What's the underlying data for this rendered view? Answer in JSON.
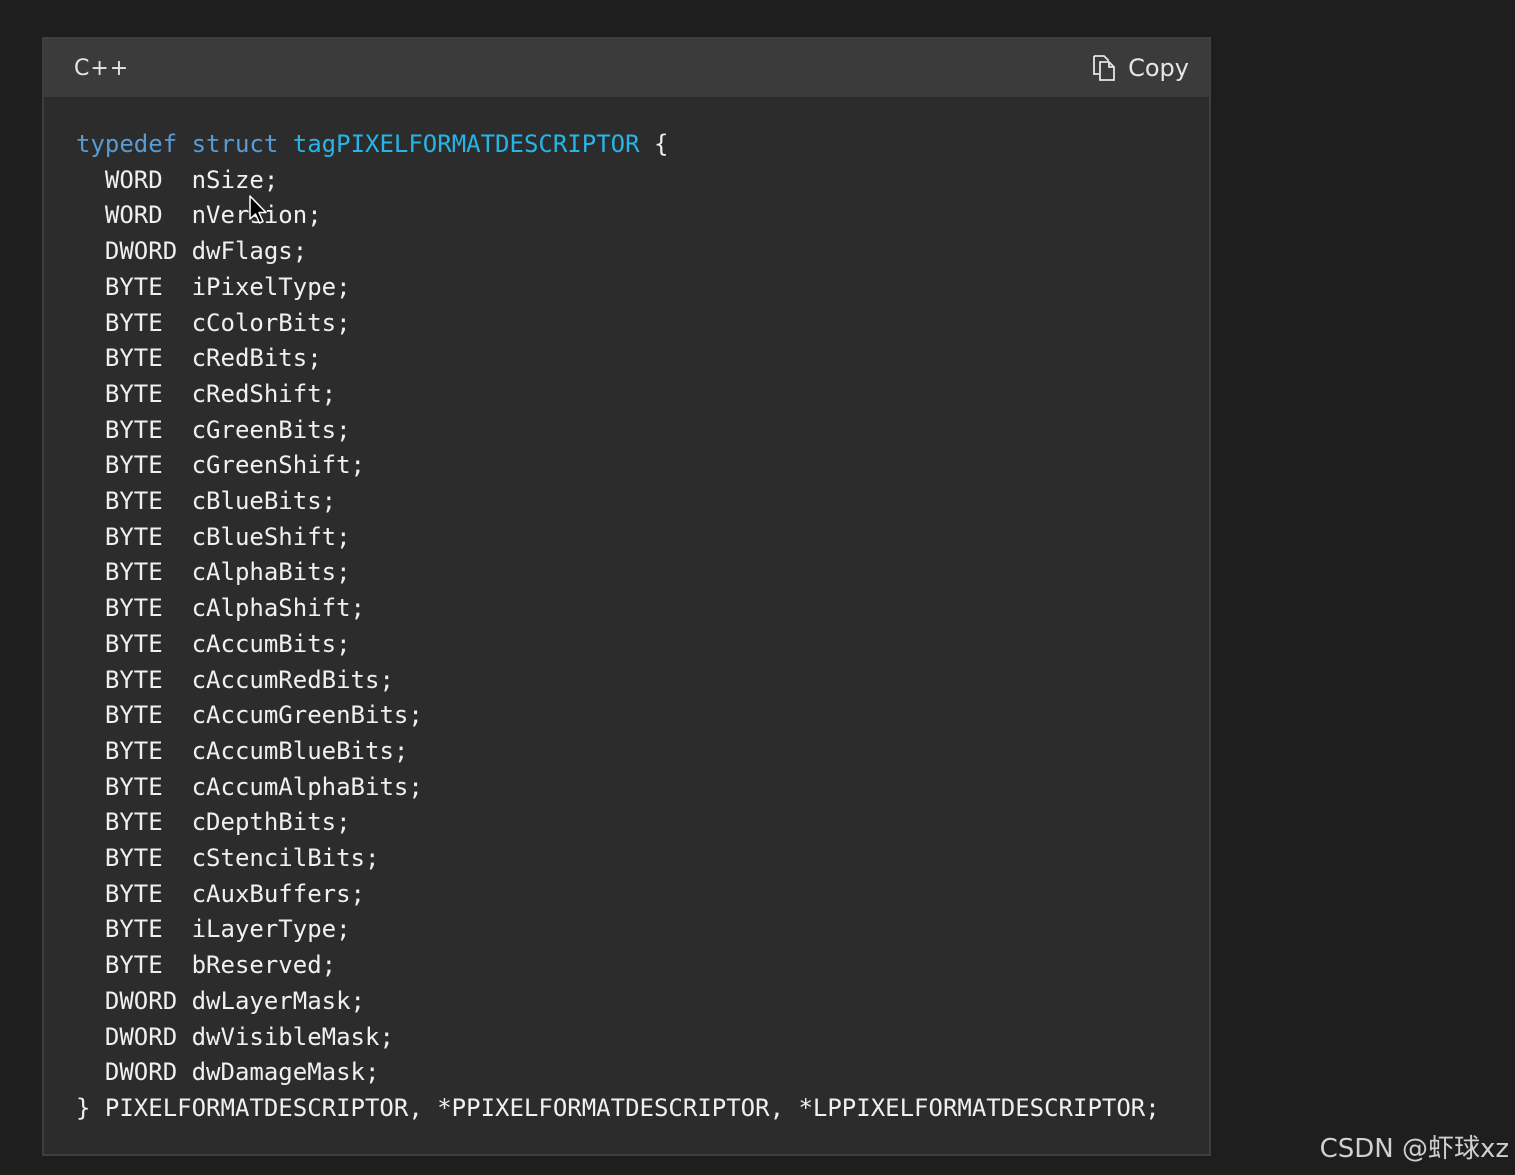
{
  "code_block": {
    "language": "C++",
    "copy_label": "Copy",
    "lines": [
      {
        "indent": "",
        "tokens": [
          {
            "t": "typedef",
            "c": "kw"
          },
          {
            "t": " ",
            "c": ""
          },
          {
            "t": "struct",
            "c": "kw"
          },
          {
            "t": " ",
            "c": ""
          },
          {
            "t": "tagPIXELFORMATDESCRIPTOR",
            "c": "tn"
          },
          {
            "t": " {",
            "c": ""
          }
        ]
      },
      {
        "indent": "  ",
        "tokens": [
          {
            "t": "WORD  nSize;",
            "c": ""
          }
        ]
      },
      {
        "indent": "  ",
        "tokens": [
          {
            "t": "WORD  nVersion;",
            "c": ""
          }
        ]
      },
      {
        "indent": "  ",
        "tokens": [
          {
            "t": "DWORD dwFlags;",
            "c": ""
          }
        ]
      },
      {
        "indent": "  ",
        "tokens": [
          {
            "t": "BYTE  iPixelType;",
            "c": ""
          }
        ]
      },
      {
        "indent": "  ",
        "tokens": [
          {
            "t": "BYTE  cColorBits;",
            "c": ""
          }
        ]
      },
      {
        "indent": "  ",
        "tokens": [
          {
            "t": "BYTE  cRedBits;",
            "c": ""
          }
        ]
      },
      {
        "indent": "  ",
        "tokens": [
          {
            "t": "BYTE  cRedShift;",
            "c": ""
          }
        ]
      },
      {
        "indent": "  ",
        "tokens": [
          {
            "t": "BYTE  cGreenBits;",
            "c": ""
          }
        ]
      },
      {
        "indent": "  ",
        "tokens": [
          {
            "t": "BYTE  cGreenShift;",
            "c": ""
          }
        ]
      },
      {
        "indent": "  ",
        "tokens": [
          {
            "t": "BYTE  cBlueBits;",
            "c": ""
          }
        ]
      },
      {
        "indent": "  ",
        "tokens": [
          {
            "t": "BYTE  cBlueShift;",
            "c": ""
          }
        ]
      },
      {
        "indent": "  ",
        "tokens": [
          {
            "t": "BYTE  cAlphaBits;",
            "c": ""
          }
        ]
      },
      {
        "indent": "  ",
        "tokens": [
          {
            "t": "BYTE  cAlphaShift;",
            "c": ""
          }
        ]
      },
      {
        "indent": "  ",
        "tokens": [
          {
            "t": "BYTE  cAccumBits;",
            "c": ""
          }
        ]
      },
      {
        "indent": "  ",
        "tokens": [
          {
            "t": "BYTE  cAccumRedBits;",
            "c": ""
          }
        ]
      },
      {
        "indent": "  ",
        "tokens": [
          {
            "t": "BYTE  cAccumGreenBits;",
            "c": ""
          }
        ]
      },
      {
        "indent": "  ",
        "tokens": [
          {
            "t": "BYTE  cAccumBlueBits;",
            "c": ""
          }
        ]
      },
      {
        "indent": "  ",
        "tokens": [
          {
            "t": "BYTE  cAccumAlphaBits;",
            "c": ""
          }
        ]
      },
      {
        "indent": "  ",
        "tokens": [
          {
            "t": "BYTE  cDepthBits;",
            "c": ""
          }
        ]
      },
      {
        "indent": "  ",
        "tokens": [
          {
            "t": "BYTE  cStencilBits;",
            "c": ""
          }
        ]
      },
      {
        "indent": "  ",
        "tokens": [
          {
            "t": "BYTE  cAuxBuffers;",
            "c": ""
          }
        ]
      },
      {
        "indent": "  ",
        "tokens": [
          {
            "t": "BYTE  iLayerType;",
            "c": ""
          }
        ]
      },
      {
        "indent": "  ",
        "tokens": [
          {
            "t": "BYTE  bReserved;",
            "c": ""
          }
        ]
      },
      {
        "indent": "  ",
        "tokens": [
          {
            "t": "DWORD dwLayerMask;",
            "c": ""
          }
        ]
      },
      {
        "indent": "  ",
        "tokens": [
          {
            "t": "DWORD dwVisibleMask;",
            "c": ""
          }
        ]
      },
      {
        "indent": "  ",
        "tokens": [
          {
            "t": "DWORD dwDamageMask;",
            "c": ""
          }
        ]
      },
      {
        "indent": "",
        "tokens": [
          {
            "t": "} PIXELFORMATDESCRIPTOR, *PPIXELFORMATDESCRIPTOR, *LPPIXELFORMATDESCRIPTOR;",
            "c": ""
          }
        ]
      }
    ]
  },
  "icons": {
    "copy": "copy-icon",
    "cursor": "mouse-pointer-icon"
  },
  "colors": {
    "page_bg": "#1e1e1e",
    "code_bg": "#2c2c2c",
    "header_bg": "#3b3b3b",
    "keyword": "#569cd6",
    "type_name": "#26b5e7",
    "text": "#f0f0f0"
  },
  "watermark": "CSDN @虾球xz"
}
